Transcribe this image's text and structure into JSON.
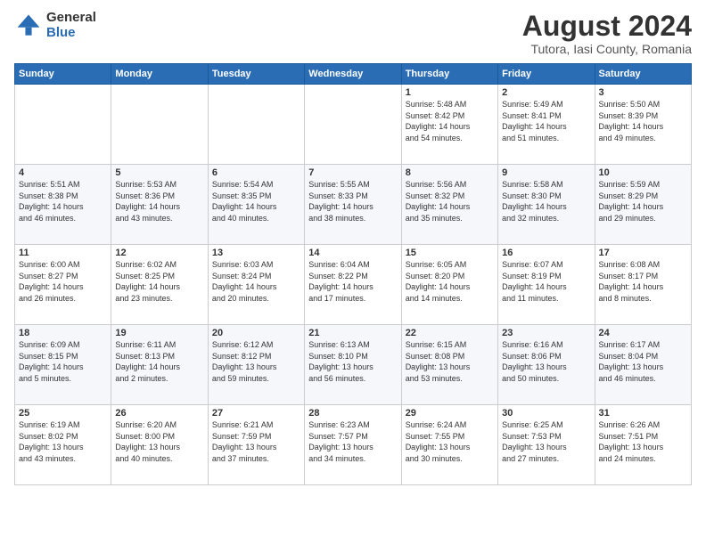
{
  "header": {
    "logo_general": "General",
    "logo_blue": "Blue",
    "title": "August 2024",
    "subtitle": "Tutora, Iasi County, Romania"
  },
  "days_of_week": [
    "Sunday",
    "Monday",
    "Tuesday",
    "Wednesday",
    "Thursday",
    "Friday",
    "Saturday"
  ],
  "weeks": [
    [
      {
        "day": "",
        "text": ""
      },
      {
        "day": "",
        "text": ""
      },
      {
        "day": "",
        "text": ""
      },
      {
        "day": "",
        "text": ""
      },
      {
        "day": "1",
        "text": "Sunrise: 5:48 AM\nSunset: 8:42 PM\nDaylight: 14 hours\nand 54 minutes."
      },
      {
        "day": "2",
        "text": "Sunrise: 5:49 AM\nSunset: 8:41 PM\nDaylight: 14 hours\nand 51 minutes."
      },
      {
        "day": "3",
        "text": "Sunrise: 5:50 AM\nSunset: 8:39 PM\nDaylight: 14 hours\nand 49 minutes."
      }
    ],
    [
      {
        "day": "4",
        "text": "Sunrise: 5:51 AM\nSunset: 8:38 PM\nDaylight: 14 hours\nand 46 minutes."
      },
      {
        "day": "5",
        "text": "Sunrise: 5:53 AM\nSunset: 8:36 PM\nDaylight: 14 hours\nand 43 minutes."
      },
      {
        "day": "6",
        "text": "Sunrise: 5:54 AM\nSunset: 8:35 PM\nDaylight: 14 hours\nand 40 minutes."
      },
      {
        "day": "7",
        "text": "Sunrise: 5:55 AM\nSunset: 8:33 PM\nDaylight: 14 hours\nand 38 minutes."
      },
      {
        "day": "8",
        "text": "Sunrise: 5:56 AM\nSunset: 8:32 PM\nDaylight: 14 hours\nand 35 minutes."
      },
      {
        "day": "9",
        "text": "Sunrise: 5:58 AM\nSunset: 8:30 PM\nDaylight: 14 hours\nand 32 minutes."
      },
      {
        "day": "10",
        "text": "Sunrise: 5:59 AM\nSunset: 8:29 PM\nDaylight: 14 hours\nand 29 minutes."
      }
    ],
    [
      {
        "day": "11",
        "text": "Sunrise: 6:00 AM\nSunset: 8:27 PM\nDaylight: 14 hours\nand 26 minutes."
      },
      {
        "day": "12",
        "text": "Sunrise: 6:02 AM\nSunset: 8:25 PM\nDaylight: 14 hours\nand 23 minutes."
      },
      {
        "day": "13",
        "text": "Sunrise: 6:03 AM\nSunset: 8:24 PM\nDaylight: 14 hours\nand 20 minutes."
      },
      {
        "day": "14",
        "text": "Sunrise: 6:04 AM\nSunset: 8:22 PM\nDaylight: 14 hours\nand 17 minutes."
      },
      {
        "day": "15",
        "text": "Sunrise: 6:05 AM\nSunset: 8:20 PM\nDaylight: 14 hours\nand 14 minutes."
      },
      {
        "day": "16",
        "text": "Sunrise: 6:07 AM\nSunset: 8:19 PM\nDaylight: 14 hours\nand 11 minutes."
      },
      {
        "day": "17",
        "text": "Sunrise: 6:08 AM\nSunset: 8:17 PM\nDaylight: 14 hours\nand 8 minutes."
      }
    ],
    [
      {
        "day": "18",
        "text": "Sunrise: 6:09 AM\nSunset: 8:15 PM\nDaylight: 14 hours\nand 5 minutes."
      },
      {
        "day": "19",
        "text": "Sunrise: 6:11 AM\nSunset: 8:13 PM\nDaylight: 14 hours\nand 2 minutes."
      },
      {
        "day": "20",
        "text": "Sunrise: 6:12 AM\nSunset: 8:12 PM\nDaylight: 13 hours\nand 59 minutes."
      },
      {
        "day": "21",
        "text": "Sunrise: 6:13 AM\nSunset: 8:10 PM\nDaylight: 13 hours\nand 56 minutes."
      },
      {
        "day": "22",
        "text": "Sunrise: 6:15 AM\nSunset: 8:08 PM\nDaylight: 13 hours\nand 53 minutes."
      },
      {
        "day": "23",
        "text": "Sunrise: 6:16 AM\nSunset: 8:06 PM\nDaylight: 13 hours\nand 50 minutes."
      },
      {
        "day": "24",
        "text": "Sunrise: 6:17 AM\nSunset: 8:04 PM\nDaylight: 13 hours\nand 46 minutes."
      }
    ],
    [
      {
        "day": "25",
        "text": "Sunrise: 6:19 AM\nSunset: 8:02 PM\nDaylight: 13 hours\nand 43 minutes."
      },
      {
        "day": "26",
        "text": "Sunrise: 6:20 AM\nSunset: 8:00 PM\nDaylight: 13 hours\nand 40 minutes."
      },
      {
        "day": "27",
        "text": "Sunrise: 6:21 AM\nSunset: 7:59 PM\nDaylight: 13 hours\nand 37 minutes."
      },
      {
        "day": "28",
        "text": "Sunrise: 6:23 AM\nSunset: 7:57 PM\nDaylight: 13 hours\nand 34 minutes."
      },
      {
        "day": "29",
        "text": "Sunrise: 6:24 AM\nSunset: 7:55 PM\nDaylight: 13 hours\nand 30 minutes."
      },
      {
        "day": "30",
        "text": "Sunrise: 6:25 AM\nSunset: 7:53 PM\nDaylight: 13 hours\nand 27 minutes."
      },
      {
        "day": "31",
        "text": "Sunrise: 6:26 AM\nSunset: 7:51 PM\nDaylight: 13 hours\nand 24 minutes."
      }
    ]
  ]
}
